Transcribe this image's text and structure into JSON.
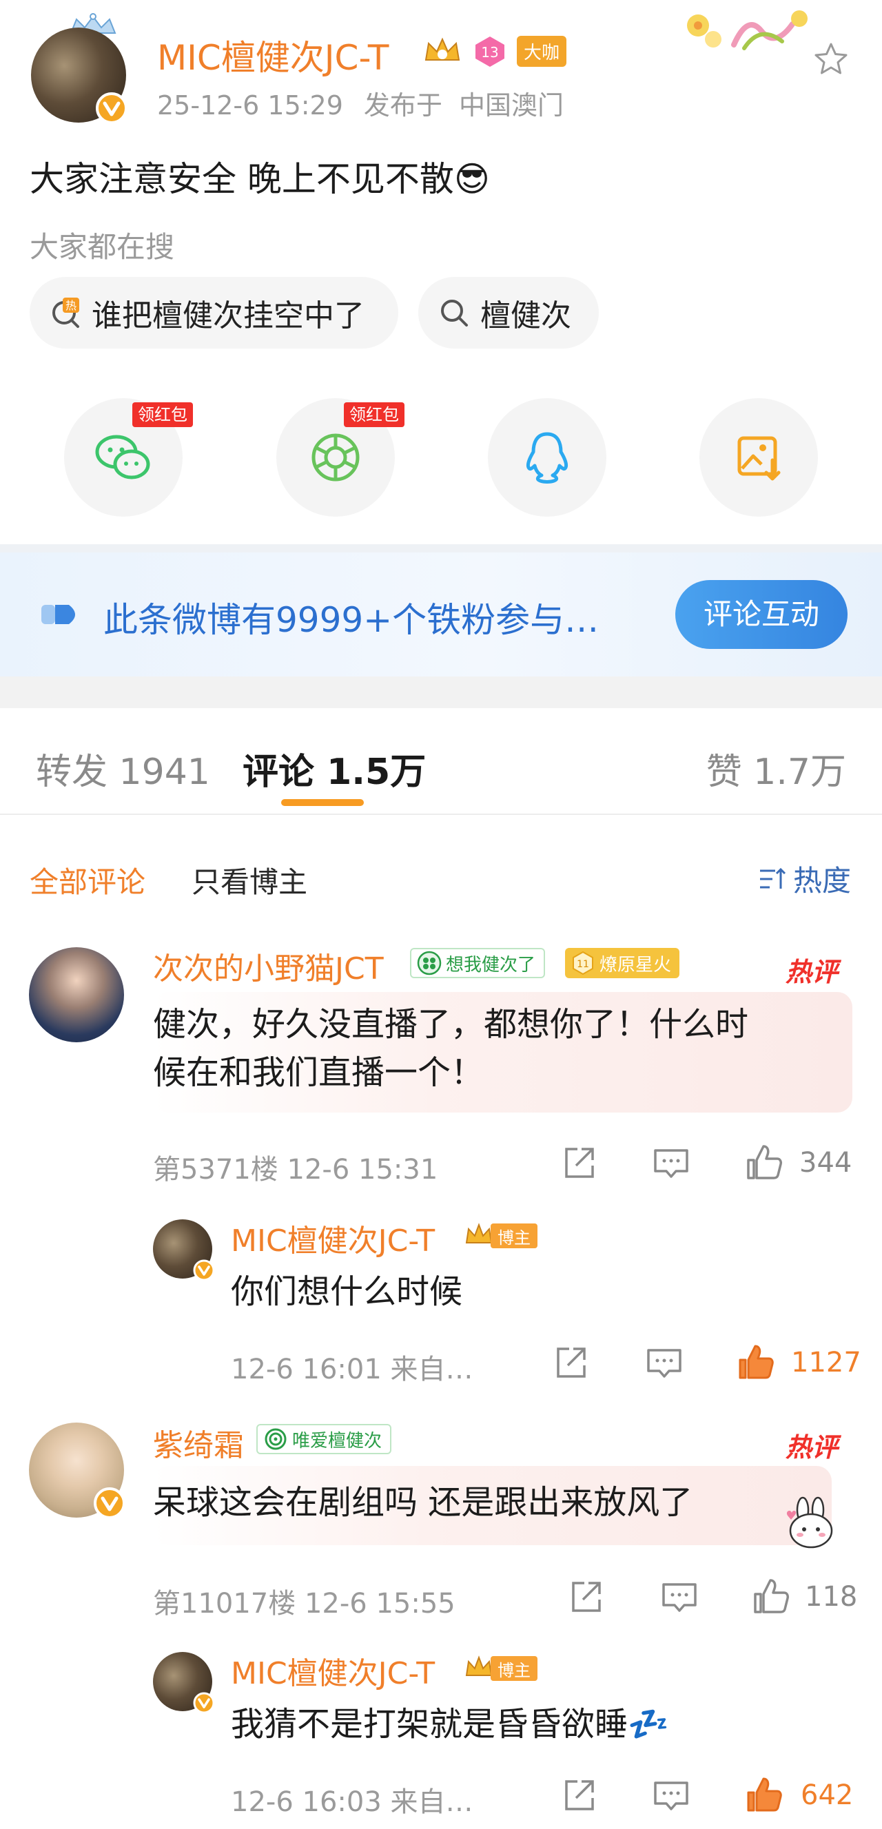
{
  "post": {
    "author": "MIC檀健次JC-T",
    "tag_daka": "大咖",
    "level_badge": "13",
    "time": "25-12-6 15:29",
    "location_prefix": "发布于",
    "location": "中国澳门",
    "text": "大家注意安全 晚上不见不散😎",
    "everyone_search_label": "大家都在搜",
    "search_chips": [
      {
        "label": "谁把檀健次挂空中了",
        "icon": "hot-search-icon"
      },
      {
        "label": "檀健次",
        "icon": "search-icon"
      }
    ],
    "share": [
      {
        "name": "wechat",
        "badge": "领红包"
      },
      {
        "name": "moments",
        "badge": "领红包"
      },
      {
        "name": "qq",
        "badge": ""
      },
      {
        "name": "save-image",
        "badge": ""
      }
    ]
  },
  "fan_banner": {
    "text": "此条微博有9999+个铁粉参与…",
    "button": "评论互动"
  },
  "tabs": {
    "repost": "转发 1941",
    "comment": "评论 1.5万",
    "like": "赞 1.7万"
  },
  "filter": {
    "all": "全部评论",
    "owner_only": "只看博主",
    "sort": "热度"
  },
  "comments": [
    {
      "name": "次次的小野猫JCT",
      "tag1": "想我健次了",
      "tag2": "燎原星火",
      "tag2_level": "11",
      "hot": "热评",
      "text_line1": "健次，好久没直播了，都想你了！什么时",
      "text_line2": "候在和我们直播一个！",
      "meta": "第5371楼  12-6 15:31",
      "likes": "344",
      "reply": {
        "name": "MIC檀健次JC-T",
        "tag": "博主",
        "text": "你们想什么时候",
        "meta": "12-6 16:01  来自…",
        "likes": "1127"
      }
    },
    {
      "name": "紫绮霜",
      "tag1": "唯爱檀健次",
      "hot": "热评",
      "text_line1": "呆球这会在剧组吗 还是跟出来放风了",
      "meta": "第11017楼  12-6 15:55",
      "likes": "118",
      "reply": {
        "name": "MIC檀健次JC-T",
        "tag": "博主",
        "text": "我猜不是打架就是昏昏欲睡💤",
        "meta": "12-6 16:03  来自…",
        "likes": "642"
      }
    }
  ],
  "colors": {
    "accent_orange": "#f07f2a",
    "link_blue": "#2b6fcf",
    "hot_red": "#f0302a"
  }
}
